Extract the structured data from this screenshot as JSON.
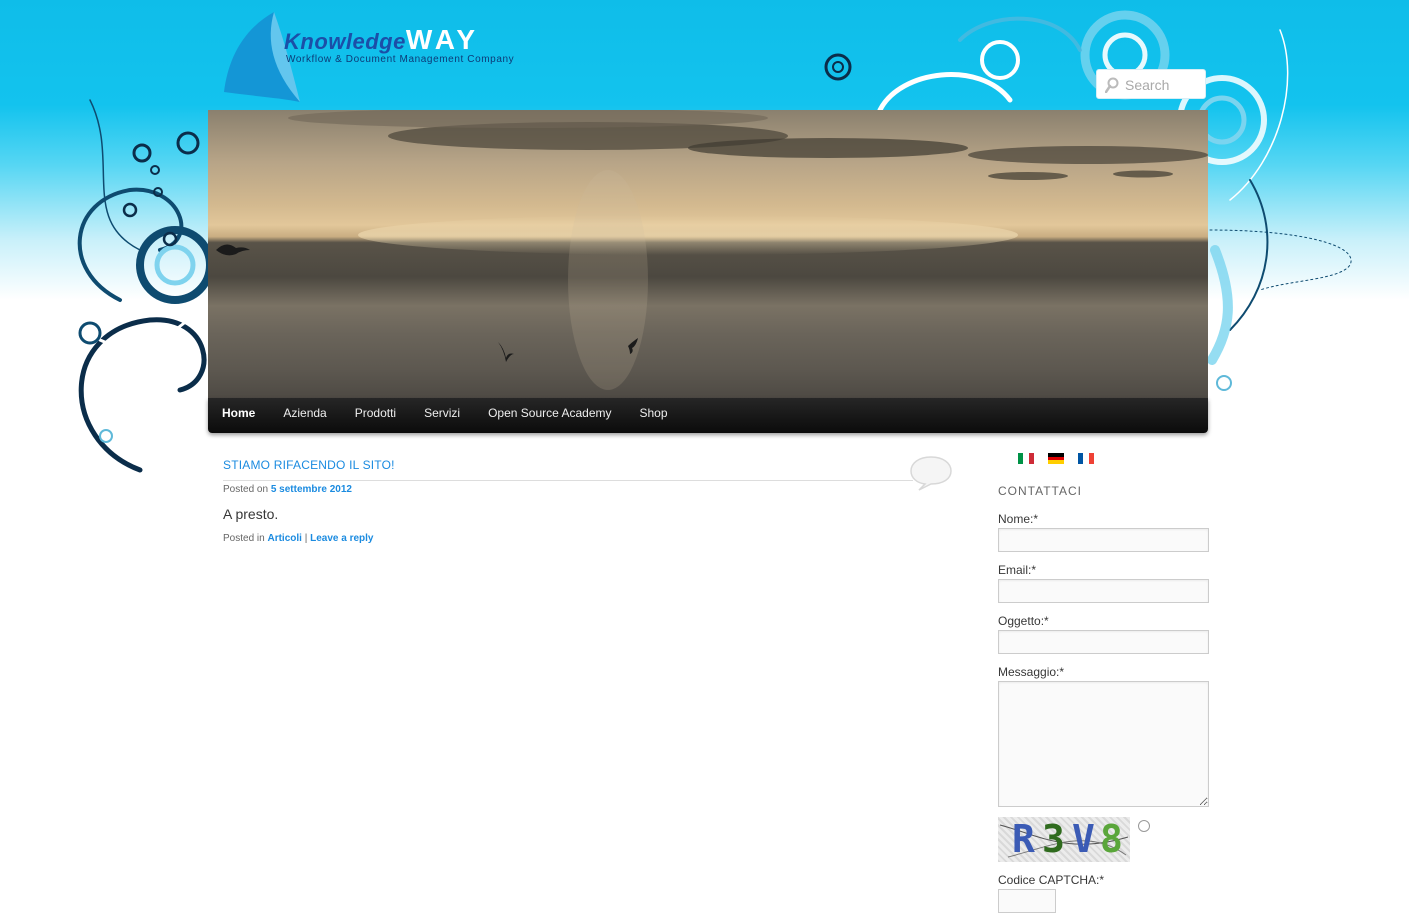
{
  "header": {
    "logo_brand_prefix": "Knowledge",
    "logo_brand_suffix": "WAY",
    "logo_tagline": "Workflow & Document Management Company",
    "search_placeholder": "Search"
  },
  "nav": {
    "items": [
      {
        "label": "Home",
        "active": true
      },
      {
        "label": "Azienda"
      },
      {
        "label": "Prodotti"
      },
      {
        "label": "Servizi"
      },
      {
        "label": "Open Source Academy"
      },
      {
        "label": "Shop"
      }
    ]
  },
  "post": {
    "title": "STIAMO RIFACENDO IL SITO!",
    "posted_on_prefix": "Posted on",
    "date": "5 settembre 2012",
    "content": "A presto.",
    "posted_in_prefix": "Posted in",
    "category": "Articoli",
    "separator": "|",
    "reply_link": "Leave a reply"
  },
  "sidebar": {
    "languages": [
      "it-flag",
      "de-flag",
      "fr-flag"
    ],
    "title": "CONTATTACI",
    "fields": {
      "name": "Nome:*",
      "email": "Email:*",
      "subject": "Oggetto:*",
      "message": "Messaggio:*",
      "captcha": "Codice CAPTCHA:*"
    },
    "captcha_chars": [
      "R",
      "3",
      "V",
      "8"
    ]
  },
  "colors": {
    "link": "#1b8be0",
    "sky": "#13c3ee",
    "nav_bg": "#0b0b0b"
  }
}
